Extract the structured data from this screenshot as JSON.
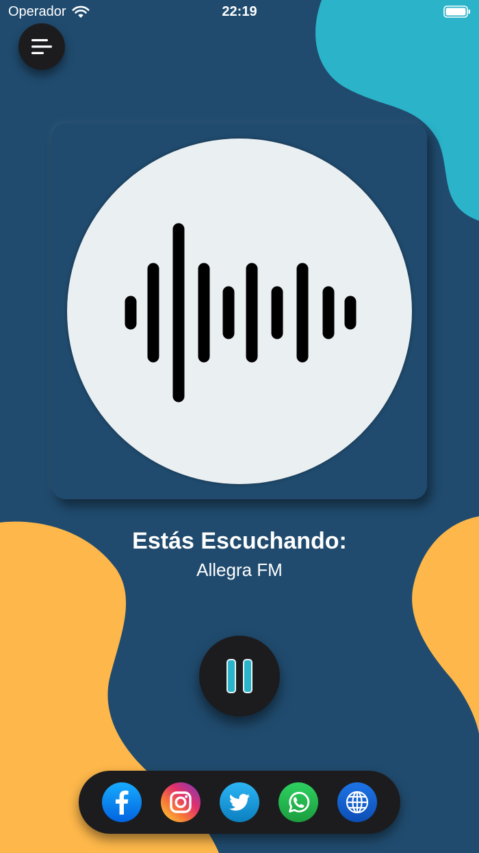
{
  "status_bar": {
    "carrier": "Operador",
    "time": "22:19",
    "icons": [
      "wifi-icon",
      "battery-icon"
    ]
  },
  "menu": {
    "icon": "menu-icon"
  },
  "artwork": {
    "icon": "waveform-icon"
  },
  "now_playing": {
    "heading": "Estás Escuchando:",
    "station": "Allegra FM"
  },
  "player": {
    "state_icon": "pause-icon",
    "accent_color": "#2bb3c9"
  },
  "social": {
    "items": [
      {
        "name": "facebook",
        "icon": "facebook-icon",
        "color": "#1877f2"
      },
      {
        "name": "instagram",
        "icon": "instagram-icon",
        "color": "#e1306c"
      },
      {
        "name": "twitter",
        "icon": "twitter-icon",
        "color": "#1da1f2"
      },
      {
        "name": "whatsapp",
        "icon": "whatsapp-icon",
        "color": "#25d366"
      },
      {
        "name": "web",
        "icon": "globe-icon",
        "color": "#1565c0"
      }
    ]
  },
  "colors": {
    "background": "#204b6e",
    "blob_teal": "#2bb3c9",
    "blob_yellow": "#fdb74a",
    "button_dark": "#1c1c1e",
    "artwork_circle": "#eaeff2"
  }
}
